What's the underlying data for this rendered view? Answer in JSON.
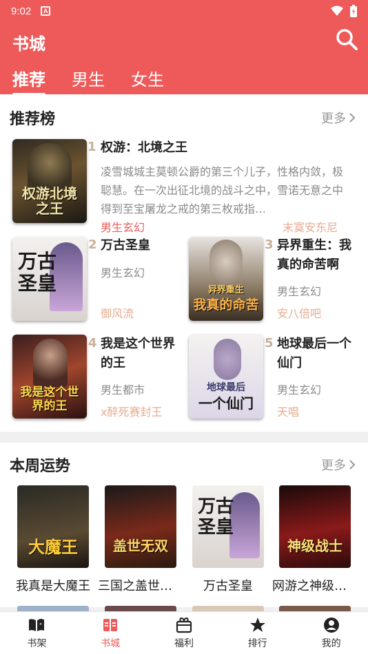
{
  "status": {
    "time": "9:02",
    "badge": "A"
  },
  "header": {
    "title": "书城",
    "tabs": [
      "推荐",
      "男生",
      "女生"
    ],
    "active_tab": 0
  },
  "recommend": {
    "title": "推荐榜",
    "more": "更多",
    "books": [
      {
        "rank": "1",
        "name": "权游：北境之王",
        "desc": "凌雪城城主莫顿公爵的第三个儿子，性格内敛，极聪慧。在一次出征北境的战斗之中，雪诺无意之中得到至宝屠龙之戒的第三枚戒指…",
        "category": "男生玄幻",
        "author": "末寞安东尼"
      },
      {
        "rank": "2",
        "name": "万古圣皇",
        "category": "男生玄幻",
        "author": "御风流"
      },
      {
        "rank": "3",
        "name": "异界重生：我真的命苦啊",
        "category": "男生玄幻",
        "author": "安八倍吧"
      },
      {
        "rank": "4",
        "name": "我是这个世界的王",
        "category": "男生都市",
        "author": "x醉死赛封王"
      },
      {
        "rank": "5",
        "name": "地球最后一个仙门",
        "category": "男生玄幻",
        "author": "天唱"
      }
    ]
  },
  "weekly": {
    "title": "本周运势",
    "more": "更多",
    "books": [
      {
        "name": "我真是大魔王"
      },
      {
        "name": "三国之盖世无双"
      },
      {
        "name": "万古圣皇"
      },
      {
        "name": "网游之神级战士"
      }
    ]
  },
  "covers": {
    "c1": "权游北境之王",
    "c2": "万古圣皇",
    "c3a": "异界重生",
    "c3b": "我真的命苦",
    "c4": "我是这个世界的王",
    "c5a": "地球最后",
    "c5b": "一个仙门",
    "w1": "大魔王",
    "w2": "盖世无双",
    "w3": "万古圣皇",
    "w4": "神级战士"
  },
  "nav": {
    "items": [
      {
        "label": "书架",
        "icon": "book-open-icon"
      },
      {
        "label": "书城",
        "icon": "bookstore-icon"
      },
      {
        "label": "福利",
        "icon": "gift-icon"
      },
      {
        "label": "排行",
        "icon": "star-icon"
      },
      {
        "label": "我的",
        "icon": "user-icon"
      }
    ],
    "active": 1
  },
  "colors": {
    "accent": "#ee5a5a",
    "author": "#e7aa8e",
    "rank": "#c8b098"
  }
}
